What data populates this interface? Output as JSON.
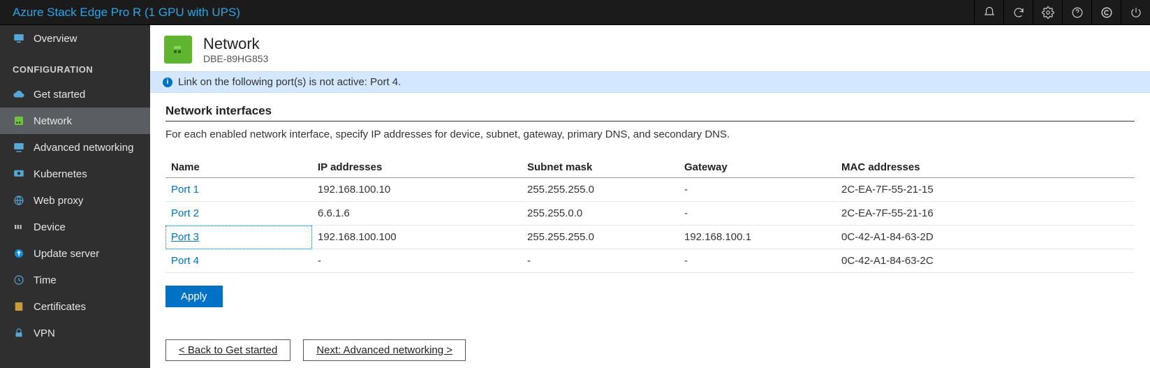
{
  "topbar": {
    "title": "Azure Stack Edge Pro R (1 GPU with UPS)"
  },
  "sidebar": {
    "overview": "Overview",
    "section": "CONFIGURATION",
    "items": [
      "Get started",
      "Network",
      "Advanced networking",
      "Kubernetes",
      "Web proxy",
      "Device",
      "Update server",
      "Time",
      "Certificates",
      "VPN"
    ]
  },
  "page": {
    "title": "Network",
    "subtitle": "DBE-89HG853"
  },
  "alert": {
    "text": "Link on the following port(s) is not active: Port 4."
  },
  "section": {
    "title": "Network interfaces",
    "desc": "For each enabled network interface, specify IP addresses for device, subnet, gateway, primary DNS, and secondary DNS."
  },
  "table": {
    "headers": [
      "Name",
      "IP addresses",
      "Subnet mask",
      "Gateway",
      "MAC addresses"
    ],
    "rows": [
      {
        "name": "Port 1",
        "ip": "192.168.100.10",
        "subnet": "255.255.255.0",
        "gateway": "-",
        "mac": "2C-EA-7F-55-21-15"
      },
      {
        "name": "Port 2",
        "ip": "6.6.1.6",
        "subnet": "255.255.0.0",
        "gateway": "-",
        "mac": "2C-EA-7F-55-21-16"
      },
      {
        "name": "Port 3",
        "ip": "192.168.100.100",
        "subnet": "255.255.255.0",
        "gateway": "192.168.100.1",
        "mac": "0C-42-A1-84-63-2D"
      },
      {
        "name": "Port 4",
        "ip": "-",
        "subnet": "-",
        "gateway": "-",
        "mac": "0C-42-A1-84-63-2C"
      }
    ]
  },
  "buttons": {
    "apply": "Apply",
    "back": "< Back to Get started",
    "next": "Next: Advanced networking >"
  }
}
